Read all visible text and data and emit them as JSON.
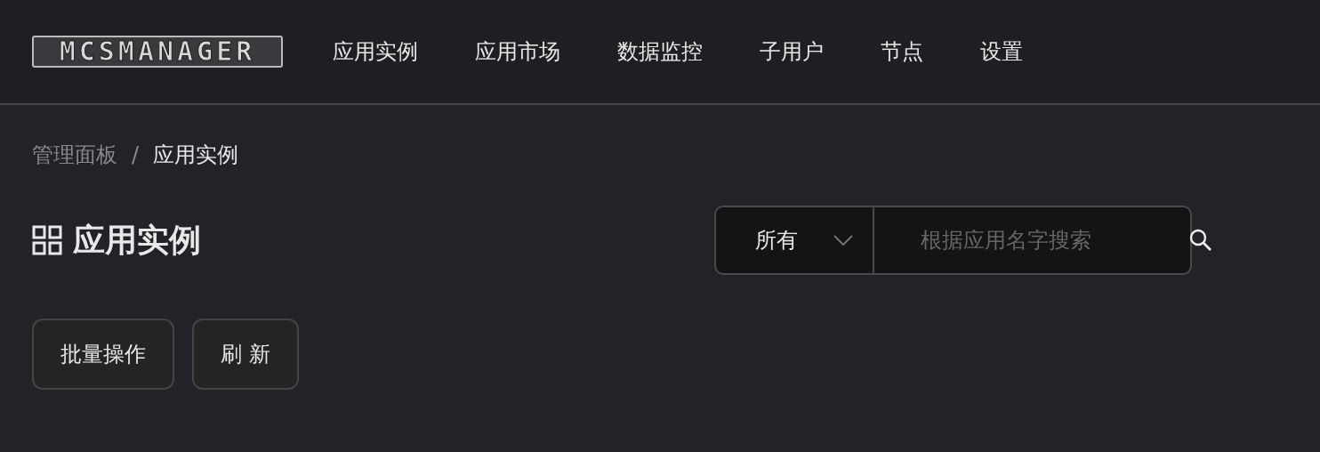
{
  "header": {
    "logo": "MCSMANAGER",
    "nav": [
      {
        "label": "应用实例"
      },
      {
        "label": "应用市场"
      },
      {
        "label": "数据监控"
      },
      {
        "label": "子用户"
      },
      {
        "label": "节点"
      },
      {
        "label": "设置"
      }
    ]
  },
  "breadcrumb": [
    "管理面板",
    "应用实例"
  ],
  "breadcrumb_separator": "/",
  "page_title": "应用实例",
  "filter": {
    "value": "所有",
    "search_placeholder": "根据应用名字搜索"
  },
  "buttons": [
    "批量操作",
    "刷 新"
  ]
}
